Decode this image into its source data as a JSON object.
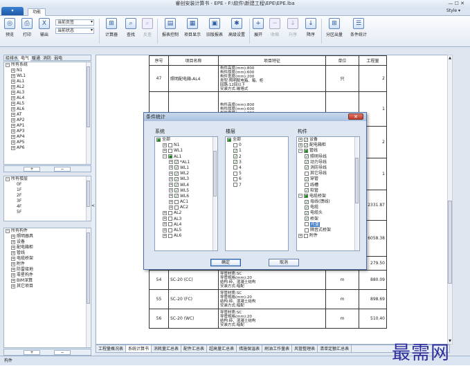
{
  "window": {
    "title": "睿创安装计算书 - EPE - F:\\软件\\新建工程\\EPE\\EPE.lba",
    "controls": "— ☐ ✕"
  },
  "ribbon": {
    "tab_function": "功能",
    "style_label": "Style ▾",
    "buttons": {
      "preview": "预览",
      "print": "打印",
      "export": "输出",
      "calculator": "计算器",
      "find": "查找",
      "replace": "反查",
      "report_control": "报表控制",
      "item_display": "项目显示",
      "old_report": "旧版报表",
      "advanced_settings": "高级设置",
      "expand": "展开",
      "collapse": "收缩",
      "sort_asc": "升序",
      "sort_desc": "降序",
      "partition_output": "分区出量",
      "condition_stats": "条件统计"
    },
    "combo_page": "当前页签",
    "combo_status": "当前状态"
  },
  "left_panel": {
    "tabs": [
      "给排水",
      "电气",
      "暖通",
      "消防",
      "弱电"
    ],
    "systems": [
      "所有系统",
      "N1",
      "WL1",
      "AL1",
      "AL2",
      "AL3",
      "AL4",
      "AL5",
      "AL6",
      "AT",
      "AP2",
      "AP1",
      "AP3",
      "AP4",
      "AP5",
      "AP6"
    ],
    "floors": [
      "所有楼层",
      "0F",
      "1F",
      "2F",
      "3F",
      "4F",
      "5F"
    ],
    "components": [
      "所有构件",
      "照明器具",
      "设备",
      "配电箱柜",
      "管线",
      "电缆桥架",
      "附件",
      "防雷接地",
      "零星构件",
      "BIM深算",
      "其它项目"
    ],
    "plus": "+",
    "minus": "−",
    "collapse_arrow": "<"
  },
  "table": {
    "headers": [
      "序号",
      "项目名称",
      "项目特征",
      "单位",
      "工程量"
    ],
    "rows": [
      {
        "no": "47",
        "name": "照明配电箱-AL4",
        "feature": "构件高度(mm):800\n构件厚度(mm):600\n构件宽度(mm):200\n类型:照明配电箱、箱、柜\n回路:12回以下\n安装方式:嵌墙式",
        "unit": "只",
        "qty": "2"
      },
      {
        "no": "",
        "name": "",
        "feature": "构件高度(mm):800\n构件厚度(mm):600\n构件宽度(mm):200",
        "unit": "",
        "qty": "1"
      },
      {
        "no": "",
        "name": "",
        "feature": "",
        "unit": "",
        "qty": "2"
      },
      {
        "no": "",
        "name": "",
        "feature": "",
        "unit": "",
        "qty": "1"
      },
      {
        "no": "",
        "name": "",
        "feature": "",
        "unit": "",
        "qty": "2331.87"
      },
      {
        "no": "",
        "name": "",
        "feature": "",
        "unit": "",
        "qty": "6058.38"
      },
      {
        "no": "53",
        "name": "SC-20 (WC)",
        "feature": "结构:砖、混凝土结构\n安装方式:暗配",
        "unit": "m",
        "qty": "279.50"
      },
      {
        "no": "54",
        "name": "SC-20 (CC)",
        "feature": "导管材质:SC\n导管规格(mm):20\n结构:砖、混凝土结构\n安装方式:暗配",
        "unit": "m",
        "qty": "880.09"
      },
      {
        "no": "55",
        "name": "SC-20 (FC)",
        "feature": "导管材质:SC\n导管规格(mm):20\n结构:砖、混凝土结构\n安装方式:暗配",
        "unit": "m",
        "qty": "898.69"
      },
      {
        "no": "56",
        "name": "SC-20 (WC)",
        "feature": "导管材质:SC\n导管规格(mm):20\n结构:砖、混凝土结构\n安装方式:暗配",
        "unit": "m",
        "qty": "510.40"
      }
    ]
  },
  "sheet_tabs": [
    "工程量概况表",
    "系统计算书",
    "消耗量汇总表",
    "配件汇总表",
    "超高量汇总表",
    "措施保温表",
    "刷油工作量表",
    "风管整理表",
    "清单定额汇总表"
  ],
  "status_text": "构件",
  "watermark": "最需网",
  "dialog": {
    "title": "条件统计",
    "close": "✕",
    "col_system": "系统",
    "col_floor": "楼层",
    "col_component": "构件",
    "systems": [
      {
        "label": "全部",
        "state": "part",
        "indent": 0
      },
      {
        "label": "N1",
        "state": "off",
        "indent": 1,
        "ex": "+"
      },
      {
        "label": "WL1",
        "state": "off",
        "indent": 1,
        "ex": "+"
      },
      {
        "label": "AL1",
        "state": "part",
        "indent": 1,
        "ex": "−"
      },
      {
        "label": "*AL1",
        "state": "on",
        "indent": 2,
        "ex": "+"
      },
      {
        "label": "WL1",
        "state": "on",
        "indent": 2,
        "ex": "+"
      },
      {
        "label": "WL2",
        "state": "on",
        "indent": 2,
        "ex": "+"
      },
      {
        "label": "WL3",
        "state": "on",
        "indent": 2,
        "ex": "+"
      },
      {
        "label": "WL4",
        "state": "on",
        "indent": 2,
        "ex": "+"
      },
      {
        "label": "WL5",
        "state": "on",
        "indent": 2,
        "ex": "+"
      },
      {
        "label": "WL6",
        "state": "on",
        "indent": 2,
        "ex": "+"
      },
      {
        "label": "AC1",
        "state": "off",
        "indent": 2,
        "ex": "+"
      },
      {
        "label": "AC2",
        "state": "off",
        "indent": 2,
        "ex": "+"
      },
      {
        "label": "AL2",
        "state": "off",
        "indent": 1,
        "ex": "+"
      },
      {
        "label": "AL3",
        "state": "off",
        "indent": 1,
        "ex": "+"
      },
      {
        "label": "AL4",
        "state": "off",
        "indent": 1,
        "ex": "+"
      },
      {
        "label": "AL5",
        "state": "off",
        "indent": 1,
        "ex": "+"
      },
      {
        "label": "AL6",
        "state": "off",
        "indent": 1,
        "ex": "+"
      }
    ],
    "floors": [
      {
        "label": "全部",
        "state": "part",
        "indent": 0
      },
      {
        "label": "0",
        "state": "off",
        "indent": 1
      },
      {
        "label": "1",
        "state": "on",
        "indent": 1
      },
      {
        "label": "2",
        "state": "on",
        "indent": 1
      },
      {
        "label": "3",
        "state": "on",
        "indent": 1
      },
      {
        "label": "4",
        "state": "off",
        "indent": 1
      },
      {
        "label": "5",
        "state": "off",
        "indent": 1
      },
      {
        "label": "6",
        "state": "off",
        "indent": 1
      },
      {
        "label": "7",
        "state": "off",
        "indent": 1
      }
    ],
    "components": [
      {
        "label": "设备",
        "state": "on",
        "indent": 0,
        "ex": "+"
      },
      {
        "label": "配电箱柜",
        "state": "on",
        "indent": 0,
        "ex": "+"
      },
      {
        "label": "管线",
        "state": "part",
        "indent": 0,
        "ex": "−"
      },
      {
        "label": "照明导线",
        "state": "on",
        "indent": 1
      },
      {
        "label": "动力导线",
        "state": "on",
        "indent": 1
      },
      {
        "label": "消防导线",
        "state": "on",
        "indent": 1
      },
      {
        "label": "其它导线",
        "state": "off",
        "indent": 1
      },
      {
        "label": "穿管",
        "state": "on",
        "indent": 1
      },
      {
        "label": "线槽",
        "state": "off",
        "indent": 1
      },
      {
        "label": "软管",
        "state": "on",
        "indent": 1
      },
      {
        "label": "电缆桥架",
        "state": "part",
        "indent": 0,
        "ex": "−"
      },
      {
        "label": "母线(馈线)",
        "state": "on",
        "indent": 1
      },
      {
        "label": "电缆",
        "state": "on",
        "indent": 1
      },
      {
        "label": "电缆头",
        "state": "on",
        "indent": 1
      },
      {
        "label": "桥架",
        "state": "on",
        "indent": 1
      },
      {
        "label": "托盘",
        "state": "off",
        "indent": 1,
        "highlight": true
      },
      {
        "label": "隔音式桥架",
        "state": "off",
        "indent": 1
      },
      {
        "label": "附件",
        "state": "off",
        "indent": 0,
        "ex": "+"
      }
    ],
    "ok": "确定",
    "cancel": "取消"
  }
}
